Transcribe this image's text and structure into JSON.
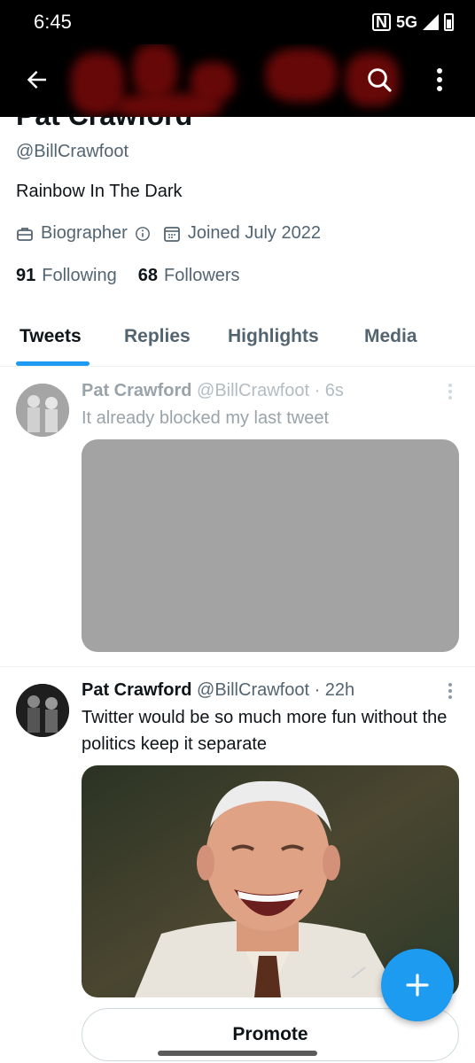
{
  "status_bar": {
    "time": "6:45",
    "nfc": "N",
    "network": "5G"
  },
  "header": {
    "back_icon": "arrow-left-icon",
    "search_icon": "search-icon",
    "more_icon": "vertical-dots-icon"
  },
  "profile": {
    "name": "Pat Crawford",
    "handle": "@BillCrawfoot",
    "bio": "Rainbow In The Dark",
    "profession": "Biographer",
    "joined": "Joined July 2022",
    "following_count": "91",
    "following_label": "Following",
    "followers_count": "68",
    "followers_label": "Followers"
  },
  "tabs": [
    {
      "label": "Tweets",
      "active": true
    },
    {
      "label": "Replies"
    },
    {
      "label": "Highlights"
    },
    {
      "label": "Media"
    }
  ],
  "tweets": [
    {
      "name": "Pat Crawford",
      "meta": "@BillCrawfoot · 6s",
      "text": "It already blocked my last tweet",
      "media": "gray placeholder"
    },
    {
      "name": "Pat Crawford",
      "meta": "@BillCrawfoot · 22h",
      "text": "Twitter would be so much more fun without the politics keep it separate",
      "media": "laughing man photo"
    }
  ],
  "promote_label": "Promote",
  "colors": {
    "accent": "#1d9bf0",
    "text": "#0f1419",
    "secondary": "#536471",
    "banner": "#000000",
    "banner_red": "#7a0a0a"
  }
}
